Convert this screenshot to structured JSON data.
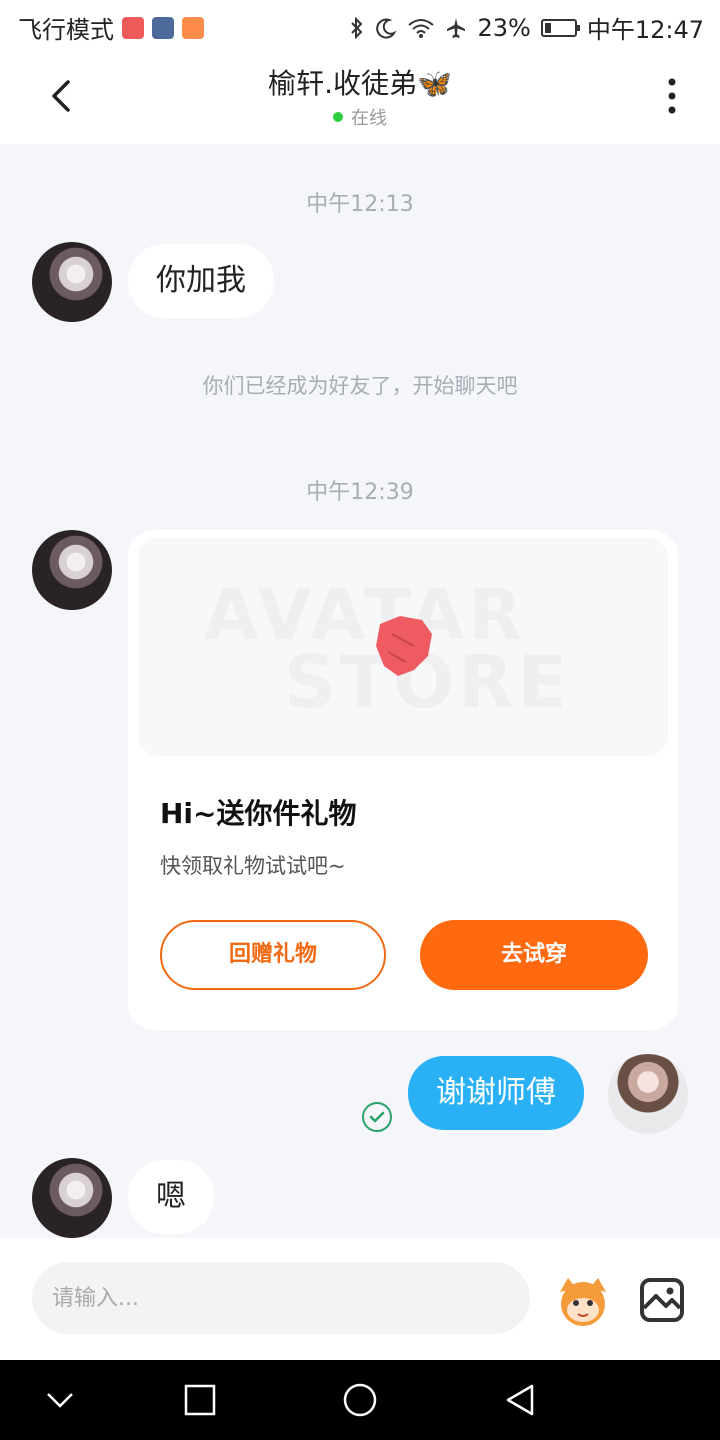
{
  "status_bar": {
    "left_text": "飞行模式",
    "battery_text": "23%",
    "time": "中午12:47",
    "battery_level": 0.23,
    "app_icon_colors": [
      "#ef5b5b",
      "#4d6a9b",
      "#ff8c4a"
    ]
  },
  "header": {
    "title": "榆轩.收徒弟🦋",
    "status": "在线",
    "status_color": "#2ecc40"
  },
  "chat": {
    "times": [
      "中午12:13",
      "中午12:39"
    ],
    "system_message": "你们已经成为好友了，开始聊天吧",
    "messages": {
      "m1": "你加我",
      "m2": "谢谢师傅",
      "m3": "嗯"
    },
    "gift_card": {
      "watermark_top": "AVATAR",
      "watermark_bottom": "STORE",
      "title": "Hi~送你件礼物",
      "subtitle": "快领取礼物试试吧~",
      "return_gift_button": "回赠礼物",
      "try_on_button": "去试穿",
      "accent_color": "#ff6a10"
    },
    "bubble_color_mine": "#2ab1f5"
  },
  "input_bar": {
    "placeholder": "请输入..."
  },
  "icons": {
    "status_left": [
      "airplane-mode-text",
      "app-icon-1",
      "app-icon-2",
      "app-icon-3"
    ],
    "status_right": [
      "bluetooth-icon",
      "moon-icon",
      "wifi-icon",
      "airplane-icon",
      "battery-icon"
    ],
    "header": [
      "back-arrow-icon",
      "more-vertical-icon"
    ],
    "input": [
      "emoji-mascot-icon",
      "image-icon"
    ],
    "nav": [
      "nav-down-icon",
      "nav-recent-icon",
      "nav-home-icon",
      "nav-back-icon"
    ]
  }
}
